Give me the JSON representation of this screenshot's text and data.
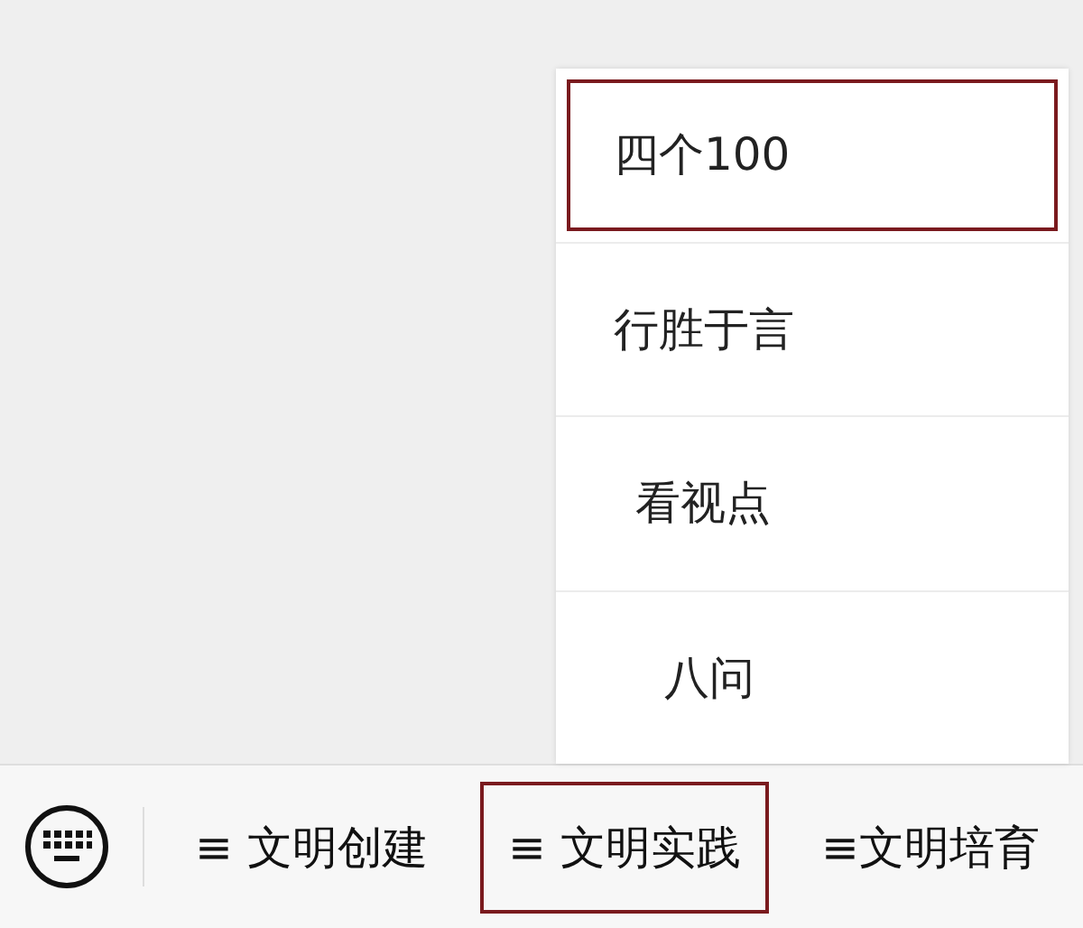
{
  "submenu": {
    "items": [
      {
        "label": "四个100",
        "selected": true
      },
      {
        "label": "行胜于言",
        "selected": false
      },
      {
        "label": "看视点",
        "selected": false
      },
      {
        "label": "八问",
        "selected": false
      }
    ]
  },
  "menu_bar": {
    "items": [
      {
        "label": "≡ 文明创建",
        "selected": false
      },
      {
        "label": "≡ 文明实践",
        "selected": true
      },
      {
        "label": "≡文明培育",
        "selected": false
      }
    ]
  }
}
